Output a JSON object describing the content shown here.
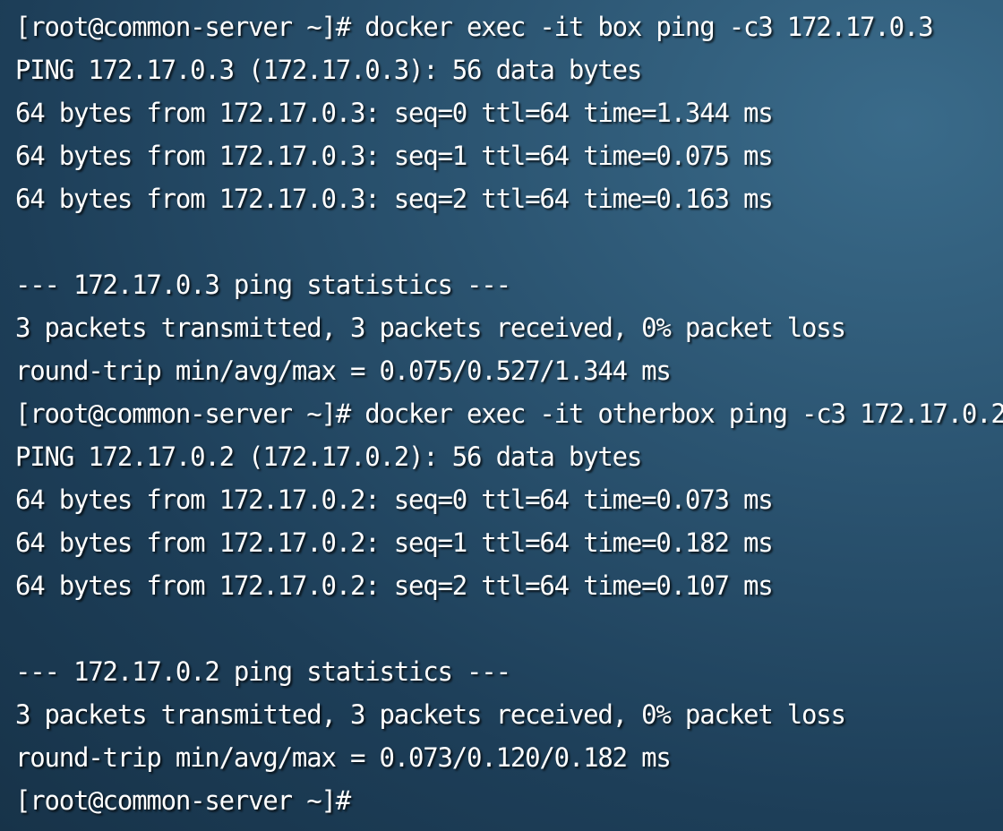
{
  "terminal": {
    "lines": [
      "[root@common-server ~]# docker exec -it box ping -c3 172.17.0.3",
      "PING 172.17.0.3 (172.17.0.3): 56 data bytes",
      "64 bytes from 172.17.0.3: seq=0 ttl=64 time=1.344 ms",
      "64 bytes from 172.17.0.3: seq=1 ttl=64 time=0.075 ms",
      "64 bytes from 172.17.0.3: seq=2 ttl=64 time=0.163 ms",
      "",
      "--- 172.17.0.3 ping statistics ---",
      "3 packets transmitted, 3 packets received, 0% packet loss",
      "round-trip min/avg/max = 0.075/0.527/1.344 ms",
      "[root@common-server ~]# docker exec -it otherbox ping -c3 172.17.0.2",
      "PING 172.17.0.2 (172.17.0.2): 56 data bytes",
      "64 bytes from 172.17.0.2: seq=0 ttl=64 time=0.073 ms",
      "64 bytes from 172.17.0.2: seq=1 ttl=64 time=0.182 ms",
      "64 bytes from 172.17.0.2: seq=2 ttl=64 time=0.107 ms",
      "",
      "--- 172.17.0.2 ping statistics ---",
      "3 packets transmitted, 3 packets received, 0% packet loss",
      "round-trip min/avg/max = 0.073/0.120/0.182 ms",
      "[root@common-server ~]#"
    ]
  }
}
